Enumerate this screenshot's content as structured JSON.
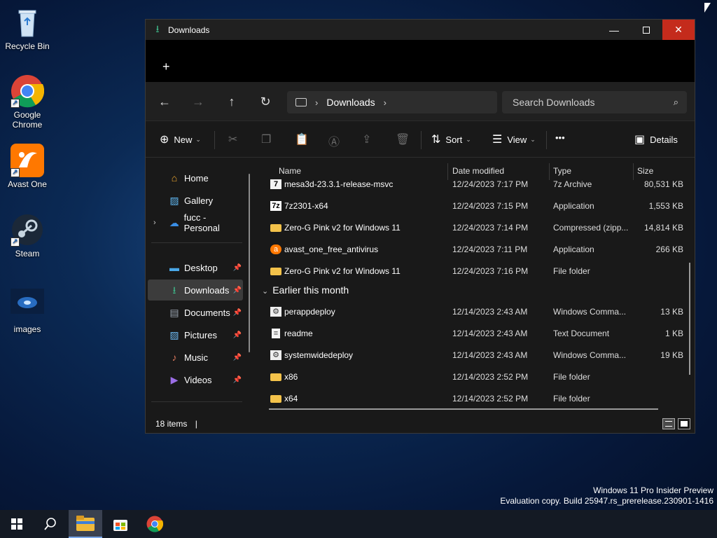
{
  "desktop": {
    "icons": [
      {
        "label": "Recycle Bin"
      },
      {
        "label": "Google Chrome"
      },
      {
        "label": "Avast One"
      },
      {
        "label": "Steam"
      },
      {
        "label": "images"
      }
    ]
  },
  "window": {
    "title": "Downloads",
    "new_tab_label": "+",
    "address": {
      "location": "Downloads"
    },
    "search": {
      "placeholder": "Search Downloads"
    },
    "toolbar": {
      "new_label": "New",
      "sort_label": "Sort",
      "view_label": "View",
      "more_label": "•••",
      "details_label": "Details"
    },
    "sidebar": {
      "items": [
        {
          "label": "Home"
        },
        {
          "label": "Gallery"
        },
        {
          "label": "fucc - Personal"
        },
        {
          "label": "Desktop"
        },
        {
          "label": "Downloads"
        },
        {
          "label": "Documents"
        },
        {
          "label": "Pictures"
        },
        {
          "label": "Music"
        },
        {
          "label": "Videos"
        }
      ]
    },
    "columns": {
      "name": "Name",
      "date": "Date modified",
      "type": "Type",
      "size": "Size"
    },
    "groups": {
      "earlier": "Earlier this month"
    },
    "files": [
      {
        "name": "mesa3d-23.3.1-release-msvc",
        "date": "12/24/2023 7:17 PM",
        "type": "7z Archive",
        "size": "80,531 KB"
      },
      {
        "name": "7z2301-x64",
        "date": "12/24/2023 7:15 PM",
        "type": "Application",
        "size": "1,553 KB"
      },
      {
        "name": "Zero-G Pink v2 for Windows 11",
        "date": "12/24/2023 7:14 PM",
        "type": "Compressed (zipp...",
        "size": "14,814 KB"
      },
      {
        "name": "avast_one_free_antivirus",
        "date": "12/24/2023 7:11 PM",
        "type": "Application",
        "size": "266 KB"
      },
      {
        "name": "Zero-G Pink v2 for Windows 11",
        "date": "12/24/2023 7:16 PM",
        "type": "File folder",
        "size": ""
      },
      {
        "name": "perappdeploy",
        "date": "12/14/2023 2:43 AM",
        "type": "Windows Comma...",
        "size": "13 KB"
      },
      {
        "name": "readme",
        "date": "12/14/2023 2:43 AM",
        "type": "Text Document",
        "size": "1 KB"
      },
      {
        "name": "systemwidedeploy",
        "date": "12/14/2023 2:43 AM",
        "type": "Windows Comma...",
        "size": "19 KB"
      },
      {
        "name": "x86",
        "date": "12/14/2023 2:52 PM",
        "type": "File folder",
        "size": ""
      },
      {
        "name": "x64",
        "date": "12/14/2023 2:52 PM",
        "type": "File folder",
        "size": ""
      }
    ],
    "status": {
      "item_count": "18 items"
    }
  },
  "watermark": {
    "line1": "Windows 11 Pro Insider Preview",
    "line2": "Evaluation copy. Build 25947.rs_prerelease.230901-1416"
  },
  "colors": {
    "accent_close": "#c42b1c",
    "folder": "#f3c24a",
    "downloads_green": "#3fb98a"
  }
}
